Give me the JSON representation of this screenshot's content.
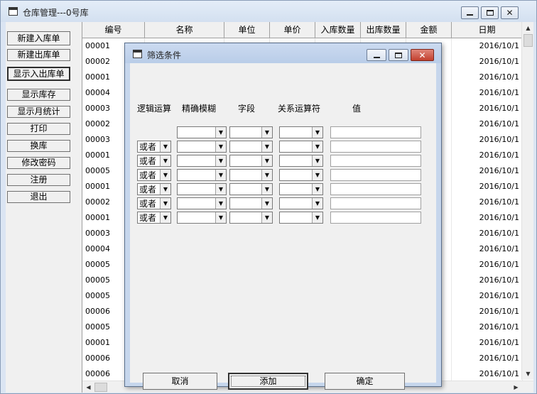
{
  "window": {
    "title": "仓库管理---0号库",
    "icon": "window-icon",
    "controls": [
      "minimize-icon",
      "maximize-icon",
      "close-icon"
    ]
  },
  "sidebar": {
    "buttons": [
      {
        "label": "新建入库单"
      },
      {
        "label": "新建出库单"
      },
      {
        "label": "显示入出库单"
      },
      {
        "label": "显示库存"
      },
      {
        "label": "显示月统计"
      },
      {
        "label": "打印"
      },
      {
        "label": "换库"
      },
      {
        "label": "修改密码"
      },
      {
        "label": "注册"
      },
      {
        "label": "退出"
      }
    ]
  },
  "grid": {
    "columns": [
      "编号",
      "名称",
      "单位",
      "单价",
      "入库数量",
      "出库数量",
      "金额",
      "日期"
    ],
    "rows": [
      {
        "id": "00001",
        "date": "2016/10/1"
      },
      {
        "id": "00002",
        "date": "2016/10/1"
      },
      {
        "id": "00001",
        "date": "2016/10/1"
      },
      {
        "id": "00004",
        "date": "2016/10/1"
      },
      {
        "id": "00003",
        "date": "2016/10/1"
      },
      {
        "id": "00002",
        "date": "2016/10/1"
      },
      {
        "id": "00003",
        "date": "2016/10/1"
      },
      {
        "id": "00001",
        "date": "2016/10/1"
      },
      {
        "id": "00005",
        "date": "2016/10/1"
      },
      {
        "id": "00001",
        "date": "2016/10/1"
      },
      {
        "id": "00002",
        "date": "2016/10/1"
      },
      {
        "id": "00001",
        "date": "2016/10/1"
      },
      {
        "id": "00003",
        "date": "2016/10/1"
      },
      {
        "id": "00004",
        "date": "2016/10/1"
      },
      {
        "id": "00005",
        "date": "2016/10/1"
      },
      {
        "id": "00005",
        "date": "2016/10/1"
      },
      {
        "id": "00005",
        "date": "2016/10/1"
      },
      {
        "id": "00006",
        "date": "2016/10/1"
      },
      {
        "id": "00005",
        "date": "2016/10/1"
      },
      {
        "id": "00001",
        "date": "2016/10/1"
      },
      {
        "id": "00006",
        "date": "2016/10/1"
      },
      {
        "id": "00006",
        "date": "2016/10/1"
      }
    ]
  },
  "dialog": {
    "title": "筛选条件",
    "headers": {
      "logic": "逻辑运算",
      "match": "精确模糊",
      "field": "字段",
      "operator": "关系运算符",
      "value": "值"
    },
    "logic_default": "或者",
    "rows": 7,
    "buttons": {
      "cancel": "取消",
      "add": "添加",
      "ok": "确定"
    }
  },
  "colors": {
    "frame": "#dbe5f3",
    "dialog_frame": "#c6d6ec",
    "close_button": "#c2402f",
    "client": "#f0f0f0"
  }
}
